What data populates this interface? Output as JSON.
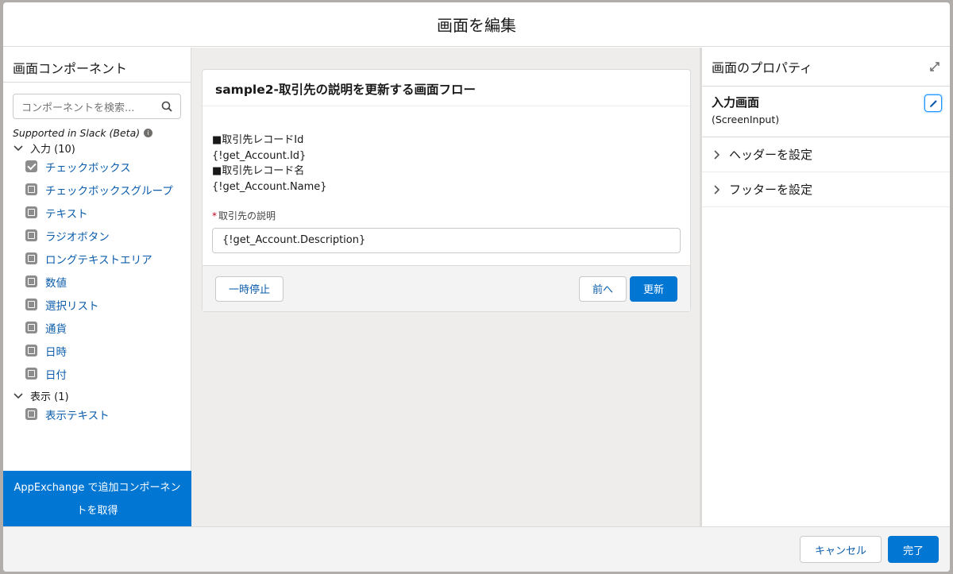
{
  "modal": {
    "title": "画面を編集"
  },
  "left_panel": {
    "title": "画面コンポーネント",
    "search_placeholder": "コンポーネントを検索...",
    "section": "Supported in Slack (Beta)",
    "group_input": "入力 (10)",
    "items_input": [
      {
        "label": "チェックボックス",
        "icon": "checkbox-icon"
      },
      {
        "label": "チェックボックスグループ",
        "icon": "checkbox-group-icon"
      },
      {
        "label": "テキスト",
        "icon": "text-icon"
      },
      {
        "label": "ラジオボタン",
        "icon": "radio-button-icon"
      },
      {
        "label": "ロングテキストエリア",
        "icon": "long-text-area-icon"
      },
      {
        "label": "数値",
        "icon": "number-icon"
      },
      {
        "label": "選択リスト",
        "icon": "picklist-icon"
      },
      {
        "label": "通貨",
        "icon": "currency-icon"
      },
      {
        "label": "日時",
        "icon": "datetime-icon"
      },
      {
        "label": "日付",
        "icon": "date-icon"
      }
    ],
    "group_display": "表示 (1)",
    "items_display": [
      {
        "label": "表示テキスト",
        "icon": "display-text-icon"
      }
    ],
    "appexchange_label": "AppExchange で追加コンポーネントを取得"
  },
  "screen_card": {
    "title": "sample2-取引先の説明を更新する画面フロー",
    "lines": [
      "■取引先レコードId",
      "{!get_Account.Id}",
      "■取引先レコード名",
      "{!get_Account.Name}"
    ],
    "field_required_mark": "*",
    "field_label": "取引先の説明",
    "field_value": "{!get_Account.Description}",
    "pause_label": "一時停止",
    "prev_label": "前へ",
    "next_label": "更新"
  },
  "right_panel": {
    "title": "画面のプロパティ",
    "element_name": "入力画面",
    "element_type": "(ScreenInput)",
    "header_section": "ヘッダーを設定",
    "footer_section": "フッターを設定"
  },
  "footer": {
    "cancel_label": "キャンセル",
    "done_label": "完了"
  },
  "colors": {
    "brand": "#0176d3",
    "link": "#0b5cab",
    "canvas": "#efedec"
  }
}
